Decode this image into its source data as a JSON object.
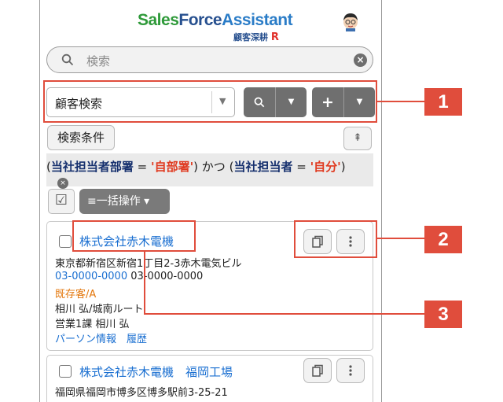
{
  "header": {
    "logo_parts": [
      "Sales",
      "Force",
      "Assistant"
    ],
    "logo_sub": "顧客深耕",
    "logo_r": "R",
    "avatar_icon": "avatar-icon"
  },
  "search": {
    "placeholder": "検索",
    "clear_icon": "clear-icon"
  },
  "toolbar": {
    "select_value": "顧客検索",
    "search_button": "search-icon",
    "add_button": "+"
  },
  "conditions": {
    "button_label": "検索条件",
    "paren_open": "(",
    "paren_close": ")",
    "eq": " = ",
    "c1_key": "当社担当者部署",
    "c1_val": "'自部署'",
    "joiner": " かつ ",
    "c2_key": "当社担当者",
    "c2_val": "'自分'"
  },
  "bulk": {
    "label": "≡一括操作 ▾"
  },
  "records": [
    {
      "name": "株式会社赤木電機",
      "address": "東京都新宿区新宿1丁目2-3赤木電気ビル",
      "phone1": "03-0000-0000",
      "phone2": "03-0000-0000",
      "status": "既存客/A",
      "rep_route": "相川 弘/城南ルート",
      "dept_rep": "営業1課  相川 弘",
      "link_person": "パーソン情報",
      "link_history": "履歴"
    },
    {
      "name": "株式会社赤木電機　福岡工場",
      "address": "福岡県福岡市博多区博多駅前3-25-21"
    }
  ],
  "callouts": [
    "1",
    "2",
    "3"
  ],
  "colors": {
    "accent": "#e04d3c",
    "link": "#1a6fd1",
    "status": "#e3770c",
    "button": "#6f6f6f"
  }
}
